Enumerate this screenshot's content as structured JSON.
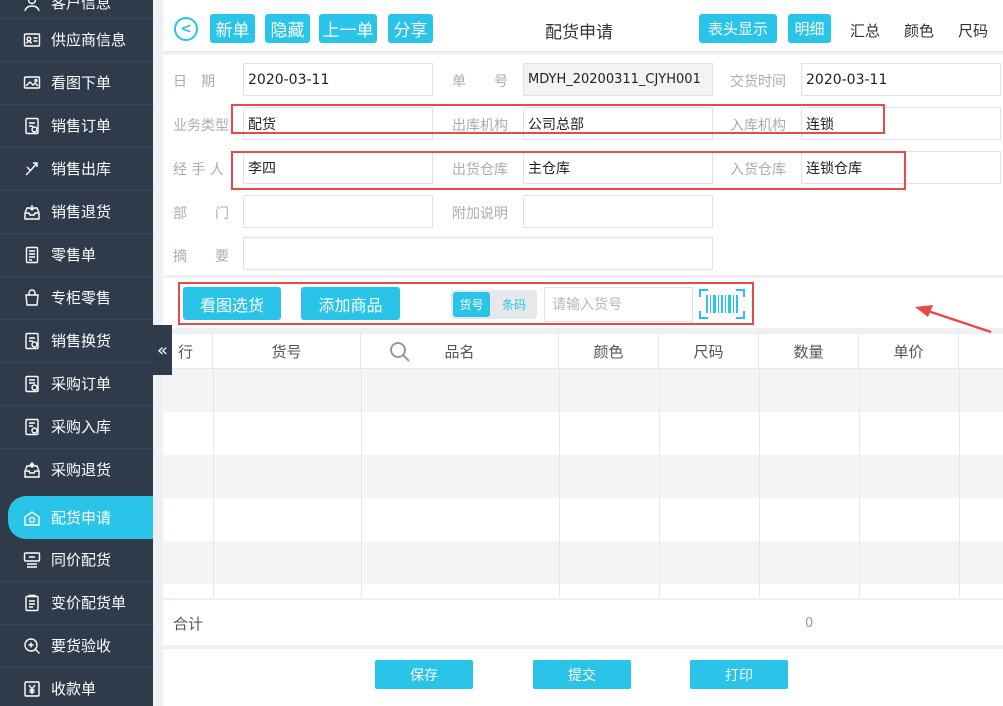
{
  "sidebar": {
    "items": [
      {
        "label": "客户信息",
        "icon": "customer-icon"
      },
      {
        "label": "供应商信息",
        "icon": "supplier-card-icon"
      },
      {
        "label": "看图下单",
        "icon": "image-order-icon"
      },
      {
        "label": "销售订单",
        "icon": "sales-order-icon"
      },
      {
        "label": "销售出库",
        "icon": "sales-out-icon"
      },
      {
        "label": "销售退货",
        "icon": "sales-return-icon"
      },
      {
        "label": "零售单",
        "icon": "retail-icon"
      },
      {
        "label": "专柜零售",
        "icon": "counter-bag-icon"
      },
      {
        "label": "销售换货",
        "icon": "exchange-icon"
      },
      {
        "label": "采购订单",
        "icon": "purchase-order-icon"
      },
      {
        "label": "采购入库",
        "icon": "purchase-in-icon"
      },
      {
        "label": "采购退货",
        "icon": "purchase-return-icon"
      },
      {
        "label": "配货申请",
        "icon": "distribution-icon",
        "active": true
      },
      {
        "label": "同价配货",
        "icon": "same-price-icon"
      },
      {
        "label": "变价配货单",
        "icon": "price-change-icon"
      },
      {
        "label": "要货验收",
        "icon": "inspect-icon"
      },
      {
        "label": "收款单",
        "icon": "receipt-yen-icon"
      }
    ]
  },
  "toolbar": {
    "title": "配货申请",
    "new_label": "新单",
    "hide_label": "隐藏",
    "prev_label": "上一单",
    "share_label": "分享",
    "header_show_label": "表头显示",
    "detail_label": "明细",
    "summary_label": "汇总",
    "color_label": "颜色",
    "size_label": "尺码"
  },
  "form": {
    "date_label": "日　期",
    "date_value": "2020-03-11",
    "order_no_label": "单　　号",
    "order_no_value": "MDYH_20200311_CJYH001",
    "delivery_time_label": "交货时间",
    "delivery_time_value": "2020-03-11",
    "biz_type_label": "业务类型",
    "biz_type_value": "配货",
    "out_org_label": "出库机构",
    "out_org_value": "公司总部",
    "in_org_label": "入库机构",
    "in_org_value": "连锁",
    "handler_label": "经 手 人",
    "handler_value": "李四",
    "out_wh_label": "出货仓库",
    "out_wh_value": "主仓库",
    "in_wh_label": "入货仓库",
    "in_wh_value": "连锁仓库",
    "dept_label": "部　　门",
    "dept_value": "",
    "note_label": "附加说明",
    "note_value": "",
    "summary_label": "摘　　要",
    "summary_value": ""
  },
  "goods_bar": {
    "pick_by_image": "看图选货",
    "add_goods": "添加商品",
    "mode_code": "货号",
    "mode_barcode": "条码",
    "code_placeholder": "请输入货号"
  },
  "table": {
    "columns": [
      "行",
      "货号",
      "品名",
      "颜色",
      "尺码",
      "数量",
      "单价"
    ],
    "rows": []
  },
  "total": {
    "label": "合计",
    "quantity": "0"
  },
  "footer": {
    "save": "保存",
    "submit": "提交",
    "print": "打印"
  },
  "colors": {
    "accent": "#29c4e8",
    "sidebar_bg": "#2f3a4a",
    "highlight_red": "#e84a4a"
  }
}
